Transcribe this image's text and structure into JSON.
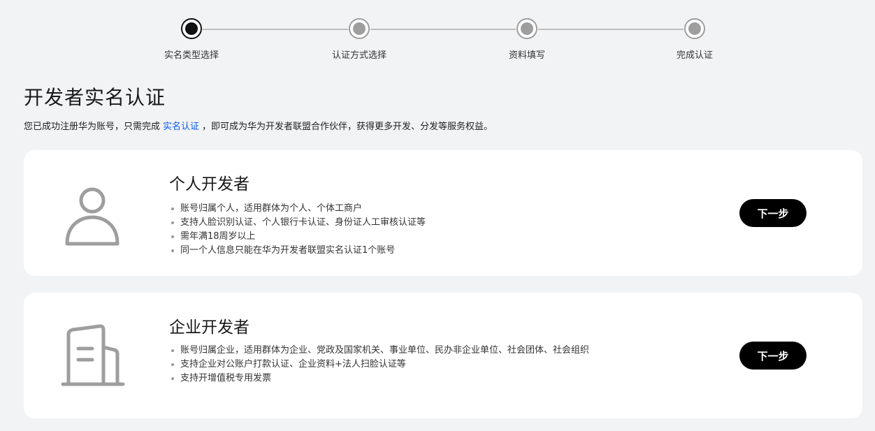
{
  "stepper": {
    "steps": [
      {
        "label": "实名类型选择",
        "active": true
      },
      {
        "label": "认证方式选择",
        "active": false
      },
      {
        "label": "资料填写",
        "active": false
      },
      {
        "label": "完成认证",
        "active": false
      }
    ]
  },
  "header": {
    "title": "开发者实名认证",
    "desc_prefix": "您已成功注册华为账号，只需完成",
    "desc_link": "实名认证",
    "desc_suffix": "，即可成为华为开发者联盟合作伙伴，获得更多开发、分发等服务权益。"
  },
  "cards": [
    {
      "icon": "person-icon",
      "title": "个人开发者",
      "bullets": [
        "账号归属个人，适用群体为个人、个体工商户",
        "支持人脸识别认证、个人银行卡认证、身份证人工审核认证等",
        "需年满18周岁以上",
        "同一个人信息只能在华为开发者联盟实名认证1个账号"
      ],
      "button": "下一步"
    },
    {
      "icon": "building-icon",
      "title": "企业开发者",
      "bullets": [
        "账号归属企业，适用群体为企业、党政及国家机关、事业单位、民办非企业单位、社会团体、社会组织",
        "支持企业对公账户打款认证、企业资料+法人扫脸认证等",
        "支持开增值税专用发票"
      ],
      "button": "下一步"
    }
  ]
}
